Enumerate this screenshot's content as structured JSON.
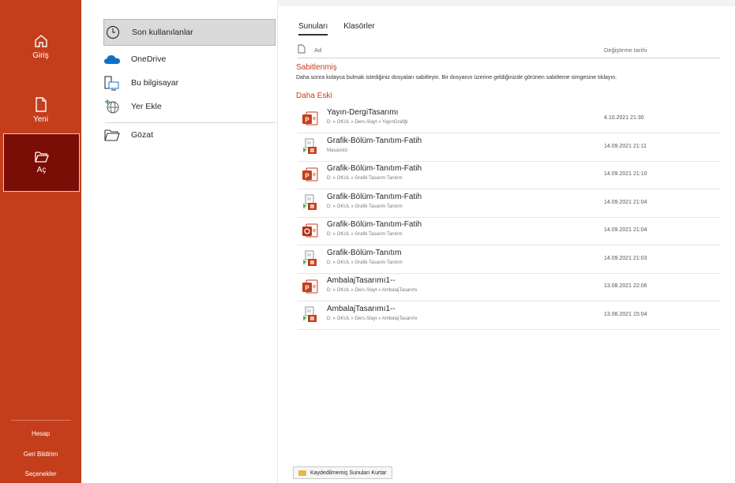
{
  "sidebar": {
    "home_label": "Giriş",
    "new_label": "Yeni",
    "open_label": "Aç",
    "account_label": "Hesap",
    "feedback_label": "Geri Bildirim",
    "options_label": "Seçenekler"
  },
  "locations": {
    "recent": "Son kullanılanlar",
    "onedrive": "OneDrive",
    "this_pc": "Bu bilgisayar",
    "add_place": "Yer Ekle",
    "browse": "Gözat"
  },
  "tabs": {
    "presentations": "Sunuları",
    "folders": "Klasörler"
  },
  "columns": {
    "name": "Ad",
    "modified": "Değiştirme tarihi"
  },
  "pinned": {
    "title": "Sabitlenmiş",
    "description": "Daha sonra kolayca bulmak istediğiniz dosyaları sabitleyin. Bir dosyanın üzerine geldiğinizde görünen sabitleme simgesine tıklayın."
  },
  "older": {
    "title": "Daha Eski",
    "files": [
      {
        "name": "Yayın-DergiTasarımı",
        "path": "D: » OKUL » Ders-Slayt » YayınGrafiği",
        "date": "4.10.2021 21:30",
        "icon": "pptx-icon"
      },
      {
        "name": "Grafik-Bölüm-Tanıtım-Fatih",
        "path": "Masaüstü",
        "date": "14.09.2021 21:11",
        "icon": "ppt-legacy-icon"
      },
      {
        "name": "Grafik-Bölüm-Tanıtım-Fatih",
        "path": "D: » OKUL » Grafik Tasarım Tanıtım",
        "date": "14.09.2021 21:10",
        "icon": "pptx-icon"
      },
      {
        "name": "Grafik-Bölüm-Tanıtım-Fatih",
        "path": "D: » OKUL » Grafik Tasarım Tanıtım",
        "date": "14.09.2021 21:04",
        "icon": "ppt-legacy-icon"
      },
      {
        "name": "Grafik-Bölüm-Tanıtım-Fatih",
        "path": "D: » OKUL » Grafik Tasarım Tanıtım",
        "date": "14.09.2021 21:04",
        "icon": "pdf-like-icon"
      },
      {
        "name": "Grafik-Bölüm-Tanıtım",
        "path": "D: » OKUL » Grafik Tasarım Tanıtım",
        "date": "14.09.2021 21:03",
        "icon": "ppt-legacy-icon"
      },
      {
        "name": "AmbalajTasarımı1--",
        "path": "D: » OKUL » Ders-Slayt » AmbalajTasarımı",
        "date": "13.08.2021 22:06",
        "icon": "pptx-icon"
      },
      {
        "name": "AmbalajTasarımı1--",
        "path": "D: » OKUL » Ders-Slayt » AmbalajTasarımı",
        "date": "13.08.2021 15:04",
        "icon": "ppt-legacy-icon"
      }
    ]
  },
  "recover_button": "Kaydedilmemiş Sunuları Kurtar",
  "colors": {
    "accent": "#c43e1c",
    "active": "#7a0e06"
  }
}
